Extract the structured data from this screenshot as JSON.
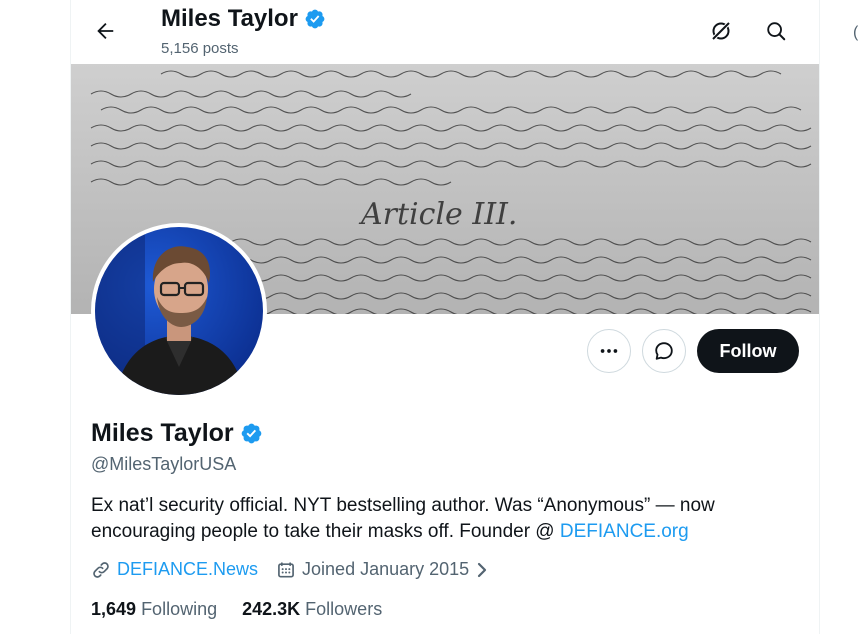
{
  "header": {
    "title": "Miles Taylor",
    "posts": "5,156 posts"
  },
  "banner": {
    "article_text": "Article III."
  },
  "actions": {
    "follow_label": "Follow"
  },
  "profile": {
    "name": "Miles Taylor",
    "handle": "@MilesTaylorUSA",
    "bio_text": "Ex nat’l security official. NYT bestselling author. Was “Anonymous” — now encouraging people to take their masks off. Founder @ ",
    "bio_link": "DEFIANCE.org",
    "website": "DEFIANCE.News",
    "joined": "Joined January 2015",
    "following_count": "1,649",
    "following_label": "Following",
    "followers_count": "242.3K",
    "followers_label": "Followers"
  },
  "colors": {
    "accent": "#1d9bf0",
    "verified": "#1d9bf0",
    "text": "#0f1419",
    "secondary": "#536471"
  },
  "icons": [
    "back-arrow-icon",
    "verified-badge-icon",
    "grok-icon",
    "search-icon",
    "more-icon",
    "message-icon",
    "link-icon",
    "calendar-icon",
    "chevron-right-icon"
  ]
}
